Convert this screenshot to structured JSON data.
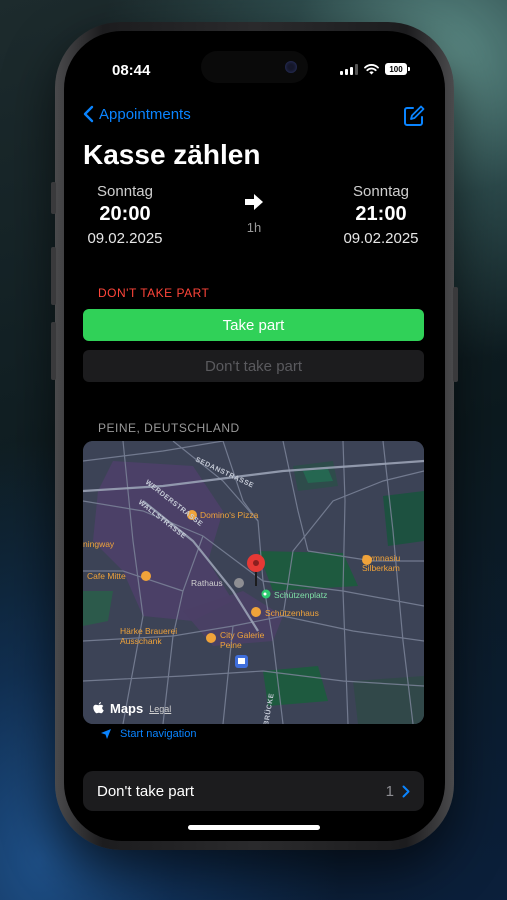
{
  "status_bar": {
    "time": "08:44",
    "battery": "100"
  },
  "nav": {
    "back_label": "Appointments"
  },
  "event": {
    "title": "Kasse zählen",
    "start": {
      "day": "Sonntag",
      "time": "20:00",
      "date": "09.02.2025"
    },
    "end": {
      "day": "Sonntag",
      "time": "21:00",
      "date": "09.02.2025"
    },
    "duration": "1h"
  },
  "participation": {
    "status_label": "DON'T TAKE PART",
    "take_part_label": "Take part",
    "dont_take_part_label": "Don't take part",
    "status_color": "#ff453a",
    "accent_color": "#30d158"
  },
  "location": {
    "label": "PEINE, DEUTSCHLAND",
    "map": {
      "streets": [
        "SEDANSTRASSE",
        "WERDERSTRASSE",
        "WALLSTRASSE",
        "BRÜCKE"
      ],
      "pois": [
        "Domino's Pizza",
        "Gymnasiu",
        "Silberkam",
        "ningway",
        "Cafe Mitte",
        "Rathaus",
        "Schützenplatz",
        "Härke Brauerei",
        "Ausschank",
        "Schützenhaus",
        "City Galerie",
        "Peine"
      ],
      "logo": "Maps",
      "legal": "Legal"
    },
    "navigation_label": "Start navigation"
  },
  "summary_row": {
    "label": "Don't take part",
    "count": "1"
  },
  "colors": {
    "link": "#0a84ff",
    "background": "#000000",
    "card": "#1c1c1e"
  }
}
